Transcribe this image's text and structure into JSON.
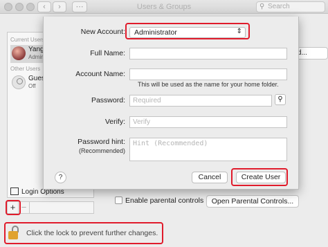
{
  "window": {
    "title": "Users & Groups",
    "search_placeholder": "Search"
  },
  "sidebar": {
    "current_users_header": "Current Users",
    "current_user": {
      "name": "Yang",
      "role": "Admin"
    },
    "other_users_header": "Other Users",
    "other_user": {
      "name": "Guest User",
      "status": "Off"
    },
    "login_options_label": "Login Options",
    "add_label": "+",
    "remove_label": "−"
  },
  "background": {
    "change_password_partial": "ord...",
    "parental_controls_label": "Enable parental controls",
    "open_parental_controls_label": "Open Parental Controls...",
    "lock_text": "Click the lock to prevent further changes."
  },
  "sheet": {
    "new_account_label": "New Account:",
    "new_account_value": "Administrator",
    "full_name_label": "Full Name:",
    "full_name_value": "",
    "account_name_label": "Account Name:",
    "account_name_value": "",
    "account_name_hint": "This will be used as the name for your home folder.",
    "password_label": "Password:",
    "password_placeholder": "Required",
    "verify_label": "Verify:",
    "verify_placeholder": "Verify",
    "hint_label": "Password hint:",
    "hint_sublabel": "(Recommended)",
    "hint_placeholder": "Hint (Recommended)",
    "help_label": "?",
    "cancel_label": "Cancel",
    "create_label": "Create User"
  },
  "colors": {
    "highlight": "#e01b2b",
    "lock": "#e0a22f"
  },
  "icons": [
    "search-icon",
    "key-icon",
    "lock-icon",
    "house-icon",
    "chevron-updown-icon",
    "back-icon",
    "forward-icon",
    "grid-icon"
  ]
}
